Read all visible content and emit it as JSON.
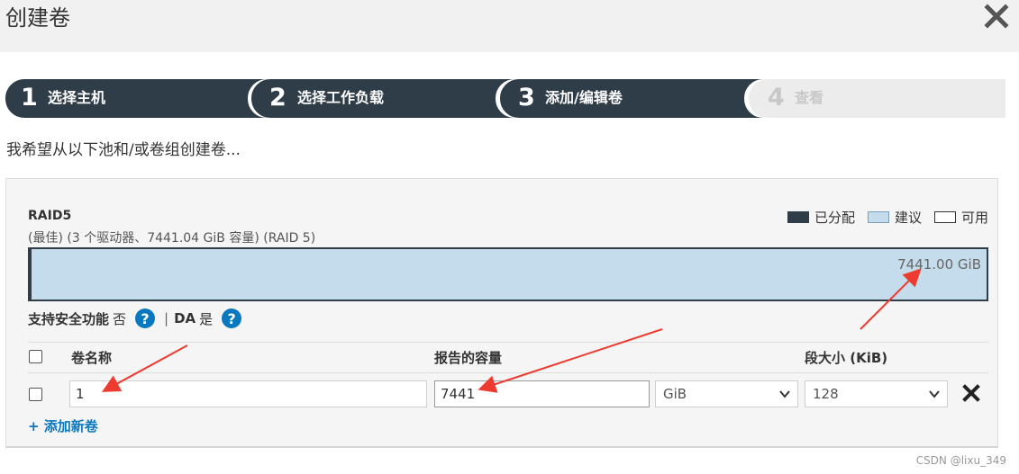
{
  "dialog": {
    "title": "创建卷",
    "close_icon": "close-icon"
  },
  "steps": [
    {
      "num": "1",
      "label": "选择主机",
      "active": true
    },
    {
      "num": "2",
      "label": "选择工作负载",
      "active": true
    },
    {
      "num": "3",
      "label": "添加/编辑卷",
      "active": true
    },
    {
      "num": "4",
      "label": "查看",
      "active": false
    }
  ],
  "intro": "我希望从以下池和/或卷组创建卷...",
  "pool": {
    "name": "RAID5",
    "subtitle": "(最佳) (3 个驱动器、7441.04 GiB 容量) (RAID 5)",
    "bar_value": "7441.00 GiB",
    "bar_suggested_fraction": 1.0
  },
  "legend": [
    {
      "label": "已分配",
      "color": "#2f3d49"
    },
    {
      "label": "建议",
      "color": "#c4dcec"
    },
    {
      "label": "可用",
      "color": "#ffffff"
    }
  ],
  "security": {
    "secure_label": "支持安全功能",
    "secure_value": "否",
    "separator": "|",
    "da_label": "DA",
    "da_value": "是",
    "help_glyph": "?"
  },
  "table": {
    "headers": {
      "name": "卷名称",
      "capacity": "报告的容量",
      "segment": "段大小 (KiB)"
    },
    "row": {
      "name_value": "1",
      "capacity_value": "7441",
      "unit_selected": "GiB",
      "segment_selected": "128"
    },
    "add_link": "+ 添加新卷"
  },
  "watermark": "CSDN @lixu_349",
  "colors": {
    "step_bg": "#2f3d49",
    "step_inactive": "#ececec",
    "link": "#0a78bf",
    "arrow": "#ee3b30"
  }
}
